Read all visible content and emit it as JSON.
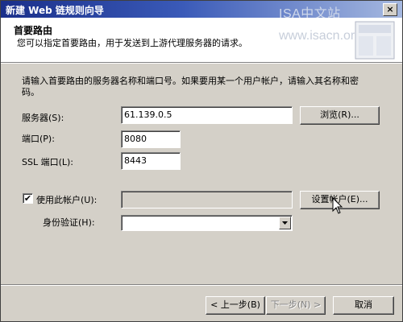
{
  "window": {
    "title": "新建 Web 链规则向导",
    "watermark": "ISA中文站",
    "watermark_url": "www.isacn.org",
    "close_label": "×"
  },
  "header": {
    "title": "首要路由",
    "subtitle": "您可以指定首要路由，用于发送到上游代理服务器的请求。"
  },
  "form": {
    "description": "请输入首要路由的服务器名称和端口号。如果要用某一个用户帐户，请输入其名称和密码。",
    "server_label": "服务器(S):",
    "server_value": "61.139.0.5",
    "browse_button": "浏览(R)...",
    "port_label": "端口(P):",
    "port_value": "8080",
    "ssl_port_label": "SSL 端口(L):",
    "ssl_port_value": "8443",
    "use_account_checked": true,
    "use_account_label": "使用此帐户(U):",
    "account_value": "",
    "set_account_button": "设置帐户(E)...",
    "auth_label": "身份验证(H):",
    "auth_value": ""
  },
  "footer": {
    "back_button": "< 上一步(B)",
    "next_button": "下一步(N) >",
    "cancel_button": "取消"
  },
  "icons": {
    "check": "✔"
  }
}
